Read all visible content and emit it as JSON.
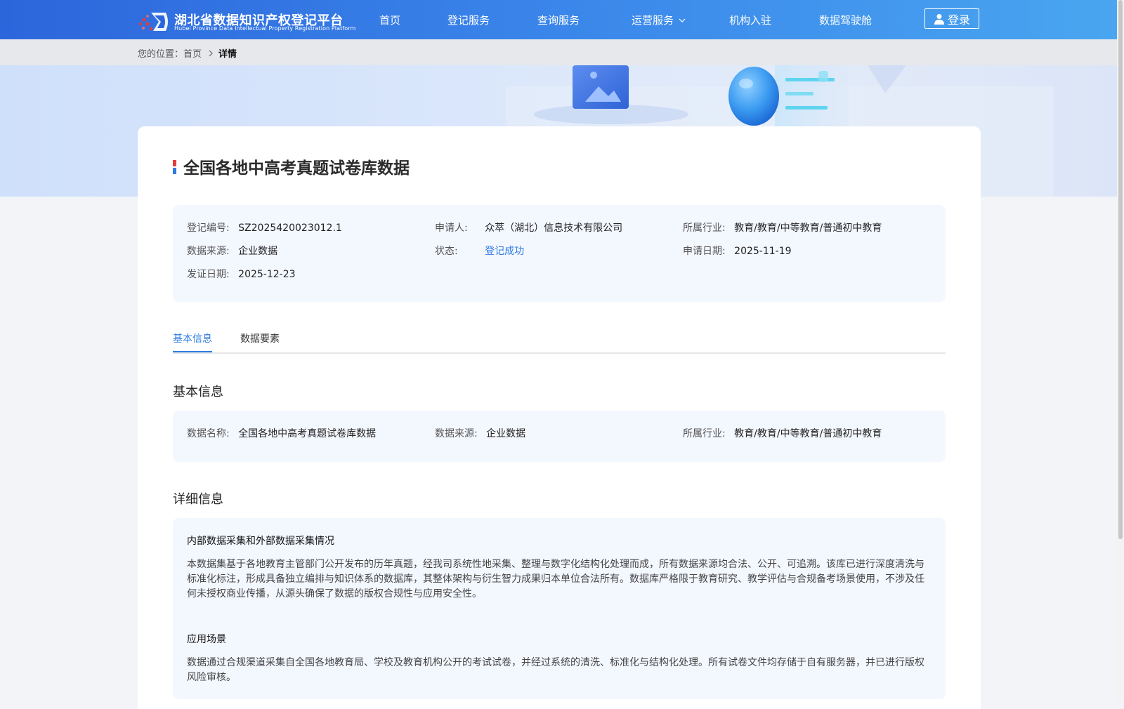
{
  "header": {
    "logo_cn": "湖北省数据知识产权登记平台",
    "logo_en": "Hubei Province Data Intellectual Property Registration Platform",
    "nav": [
      {
        "label": "首页"
      },
      {
        "label": "登记服务"
      },
      {
        "label": "查询服务"
      },
      {
        "label": "运营服务",
        "has_dropdown": true
      },
      {
        "label": "机构入驻"
      },
      {
        "label": "数据驾驶舱"
      }
    ],
    "login_label": "登录"
  },
  "breadcrumb": {
    "prefix": "您的位置：",
    "home": "首页",
    "current": "详情"
  },
  "page_title": "全国各地中高考真题试卷库数据",
  "summary": {
    "reg_no_label": "登记编号:",
    "reg_no": "SZ2025420023012.1",
    "applicant_label": "申请人:",
    "applicant": "众萃（湖北）信息技术有限公司",
    "industry_label": "所属行业:",
    "industry": "教育/教育/中等教育/普通初中教育",
    "source_label": "数据来源:",
    "source": "企业数据",
    "status_label": "状态:",
    "status": "登记成功",
    "apply_date_label": "申请日期:",
    "apply_date": "2025-11-19",
    "issue_date_label": "发证日期:",
    "issue_date": "2025-12-23"
  },
  "tabs": [
    {
      "label": "基本信息",
      "active": true
    },
    {
      "label": "数据要素",
      "active": false
    }
  ],
  "basic": {
    "title": "基本信息",
    "name_label": "数据名称:",
    "name": "全国各地中高考真题试卷库数据",
    "source_label": "数据来源:",
    "source": "企业数据",
    "industry_label": "所属行业:",
    "industry": "教育/教育/中等教育/普通初中教育"
  },
  "detail": {
    "title": "详细信息",
    "sections": [
      {
        "heading": "内部数据采集和外部数据采集情况",
        "text": "本数据集基于各地教育主管部门公开发布的历年真题，经我司系统性地采集、整理与数字化结构化处理而成，所有数据来源均合法、公开、可追溯。该库已进行深度清洗与标准化标注，形成具备独立编排与知识体系的数据库，其整体架构与衍生智力成果归本单位合法所有。数据库严格限于教育研究、教学评估与合规备考场景使用，不涉及任何未授权商业传播，从源头确保了数据的版权合规性与应用安全性。"
      },
      {
        "heading": "应用场景",
        "text": "数据通过合规渠道采集自全国各地教育局、学校及教育机构公开的考试试卷，并经过系统的清洗、标准化与结构化处理。所有试卷文件均存储于自有服务器，并已进行版权风险审核。"
      }
    ]
  },
  "colors": {
    "primary": "#2f7be3",
    "header_start": "#2c66dc",
    "header_end": "#4aa6f0",
    "panel_bg": "#f3f7fe"
  }
}
